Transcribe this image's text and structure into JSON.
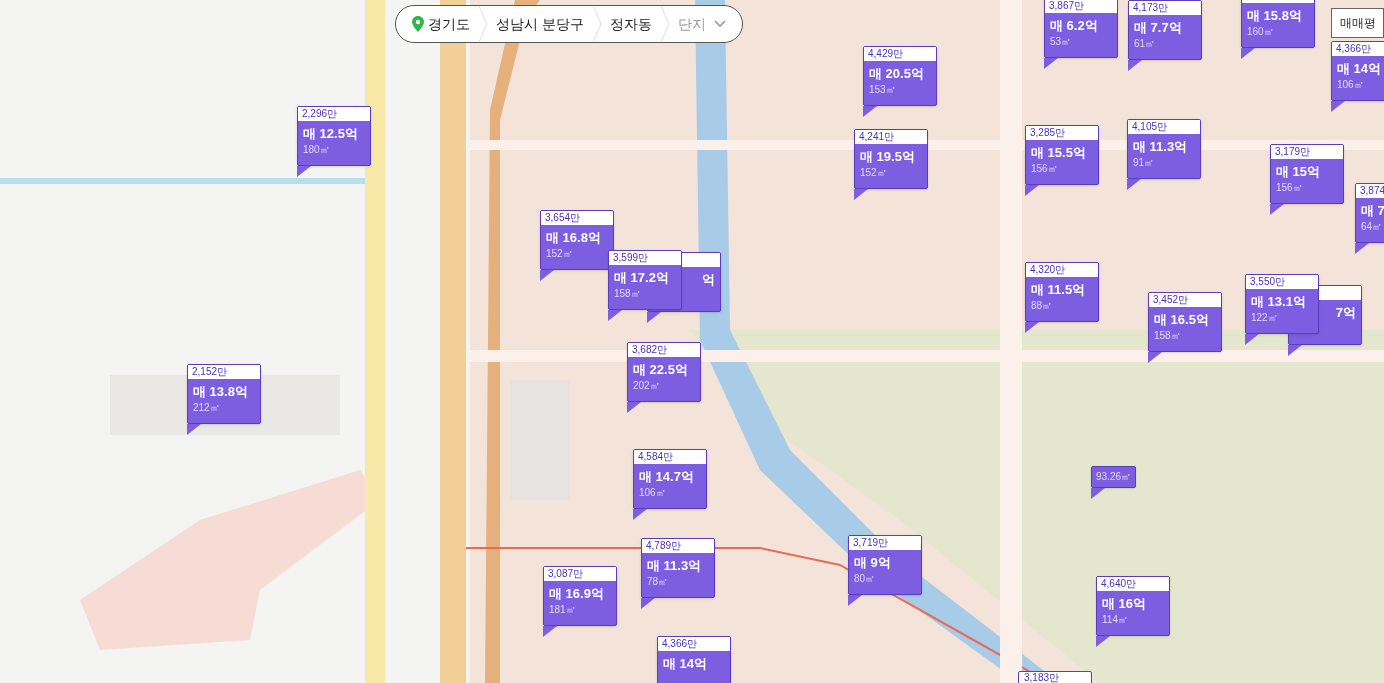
{
  "breadcrumb": [
    {
      "label": "경기도",
      "dimmed": false,
      "kind": "region"
    },
    {
      "label": "성남시 분당구",
      "dimmed": false,
      "kind": "region"
    },
    {
      "label": "정자동",
      "dimmed": false,
      "kind": "region"
    },
    {
      "label": "단지",
      "dimmed": true,
      "kind": "dropdown"
    }
  ],
  "trade_type_button": "매매평",
  "markers": [
    {
      "header": "2,296만",
      "price": "매 12.5억",
      "area": "180㎡"
    },
    {
      "header": "3,654만",
      "price": "매 16.8억",
      "area": "152㎡"
    },
    {
      "header": "3,599만",
      "price": "매 17.2억",
      "area": "158㎡"
    },
    {
      "price": "억"
    },
    {
      "header": "4,429만",
      "price": "매 20.5억",
      "area": "153㎡"
    },
    {
      "header": "3,867만",
      "price": "매 6.2억",
      "area": "53㎡"
    },
    {
      "header": "4,173만",
      "price": "매 7.7억",
      "area": "61㎡"
    },
    {
      "price": "매 15.8억",
      "area": "160㎡"
    },
    {
      "header": "4,366만",
      "price": "매 14억",
      "area": "106㎡"
    },
    {
      "header": "4,241만",
      "price": "매 19.5억",
      "area": "152㎡"
    },
    {
      "header": "3,285만",
      "price": "매 15.5억",
      "area": "156㎡"
    },
    {
      "header": "4,105만",
      "price": "매 11.3억",
      "area": "91㎡"
    },
    {
      "header": "3,179만",
      "price": "매 15억",
      "area": "156㎡"
    },
    {
      "header": "3,874",
      "price": "매 7",
      "area": "64㎡"
    },
    {
      "header": "4,320만",
      "price": "매 11.5억",
      "area": "88㎡"
    },
    {
      "header": "3,452만",
      "price": "매 16.5억",
      "area": "158㎡"
    },
    {
      "header": "3,550만",
      "price": "매 13.1억",
      "area": "122㎡"
    },
    {
      "price": "7억"
    },
    {
      "header": "2,152만",
      "price": "매 13.8억",
      "area": "212㎡"
    },
    {
      "header": "3,682만",
      "price": "매 22.5억",
      "area": "202㎡"
    },
    {
      "header": "4,584만",
      "price": "매 14.7억",
      "area": "106㎡"
    },
    {
      "header": "4,789만",
      "price": "매 11.3억",
      "area": "78㎡"
    },
    {
      "header": "3,087만",
      "price": "매 16.9억",
      "area": "181㎡"
    },
    {
      "header": "4,366만",
      "price": "매 14억"
    },
    {
      "header": "3,719만",
      "price": "매 9억",
      "area": "80㎡"
    },
    {
      "area": "93.26㎡"
    },
    {
      "header": "4,640만",
      "price": "매 16억",
      "area": "114㎡"
    },
    {
      "header": "3,183만"
    }
  ]
}
